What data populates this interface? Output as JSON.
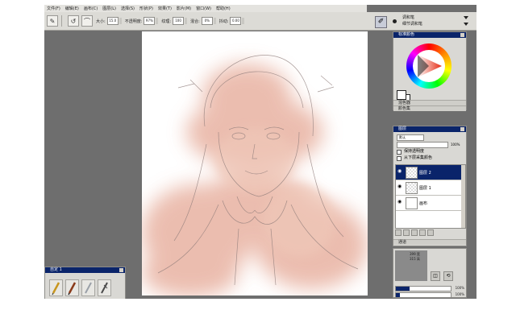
{
  "menu": [
    "文件(F)",
    "编辑(E)",
    "画布(C)",
    "图层(L)",
    "选择(S)",
    "形状(P)",
    "效果(T)",
    "影片(M)",
    "窗口(W)",
    "帮助(H)"
  ],
  "toolbar": {
    "size_label": "大小:",
    "size_value": "15.0",
    "opacity_label": "不透明度:",
    "opacity_value": "97%",
    "grain_label": "纹理:",
    "grain_value": "100",
    "blend_label": "混合:",
    "blend_value": "0%",
    "jitter_label": "抖动:",
    "jitter_value": "0.00"
  },
  "brush_selector": {
    "category": "调和笔",
    "variant": "细节调和笔"
  },
  "color_panel": {
    "title": "标准颜色",
    "sub1": "混色器",
    "sub2": "颜色集"
  },
  "layers_panel": {
    "title": "图层",
    "composite_method": "默认",
    "opacity": "100%",
    "option1": "保持透明度",
    "option2": "从下层采集颜色",
    "layers": [
      {
        "name": "图层 2",
        "selected": true
      },
      {
        "name": "图层 1",
        "selected": false
      },
      {
        "name": "画布",
        "selected": false
      }
    ]
  },
  "navigator": {
    "title": "通道",
    "width_text": "399 宽",
    "height_text": "315 高",
    "zoom_pct": "100%",
    "zoom_fraction": 0.25,
    "second_pct": "100%",
    "second_fraction": 0.08
  },
  "brush_panel": {
    "title": "自定 1"
  },
  "colors": {
    "title_bar": "#0a246a",
    "skin_tone": "#e8b2a2",
    "workspace": "#6e6e6e",
    "panel": "#d9d8d4"
  }
}
